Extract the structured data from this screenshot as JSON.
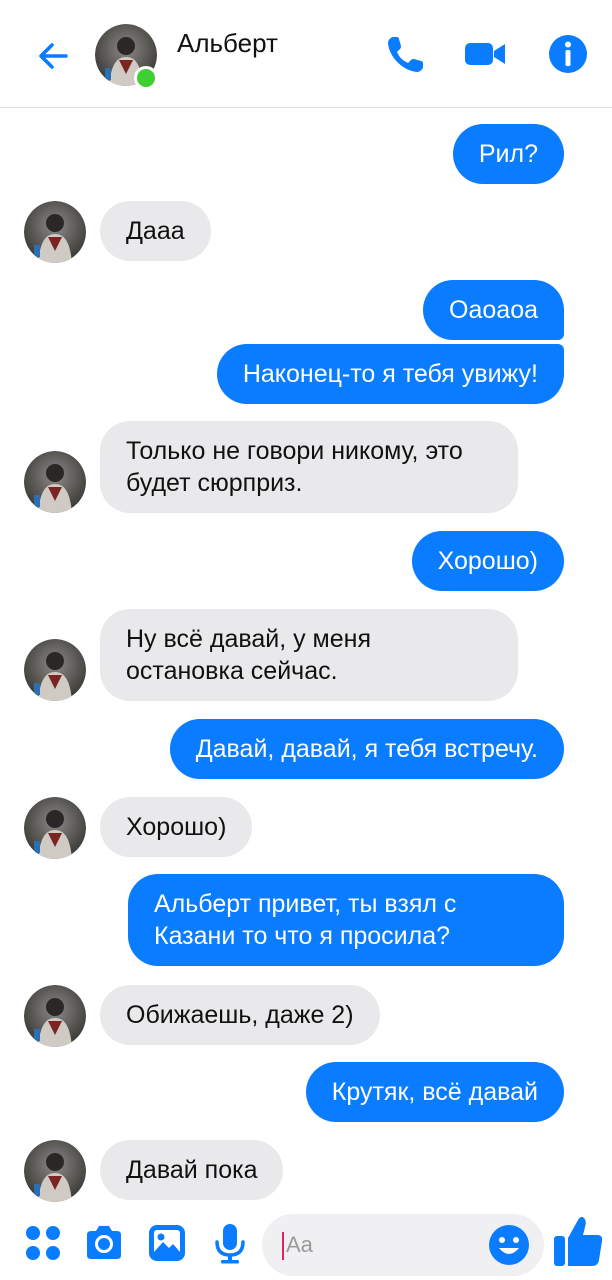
{
  "header": {
    "contact_name": "Альберт",
    "status": "online"
  },
  "messages": [
    {
      "side": "out",
      "text": "Рил?"
    },
    {
      "side": "in",
      "text": "Дааа"
    },
    {
      "side": "out",
      "text": "Оаоаоа"
    },
    {
      "side": "out",
      "text": "Наконец-то я тебя увижу!"
    },
    {
      "side": "in",
      "text": "Только не говори никому, это будет сюрприз."
    },
    {
      "side": "out",
      "text": "Хорошо)"
    },
    {
      "side": "in",
      "text": "Ну всё давай, у меня остановка сейчас."
    },
    {
      "side": "out",
      "text": "Давай, давай, я тебя встречу."
    },
    {
      "side": "in",
      "text": "Хорошо)"
    },
    {
      "side": "out",
      "text": "Альберт привет, ты взял с Казани то что я просила?"
    },
    {
      "side": "in",
      "text": "Обижаешь, даже 2)"
    },
    {
      "side": "out",
      "text": "Крутяк, всё давай"
    },
    {
      "side": "in",
      "text": "Давай пока"
    }
  ],
  "composer": {
    "placeholder": "Aa"
  },
  "colors": {
    "accent": "#0a7cff",
    "incoming_bubble": "#e9e9eb",
    "online": "#3ecf32"
  },
  "icons": [
    "back-arrow-icon",
    "phone-icon",
    "video-camera-icon",
    "info-icon",
    "menu-dots-icon",
    "camera-icon",
    "gallery-icon",
    "microphone-icon",
    "emoji-icon",
    "thumbs-up-icon"
  ]
}
